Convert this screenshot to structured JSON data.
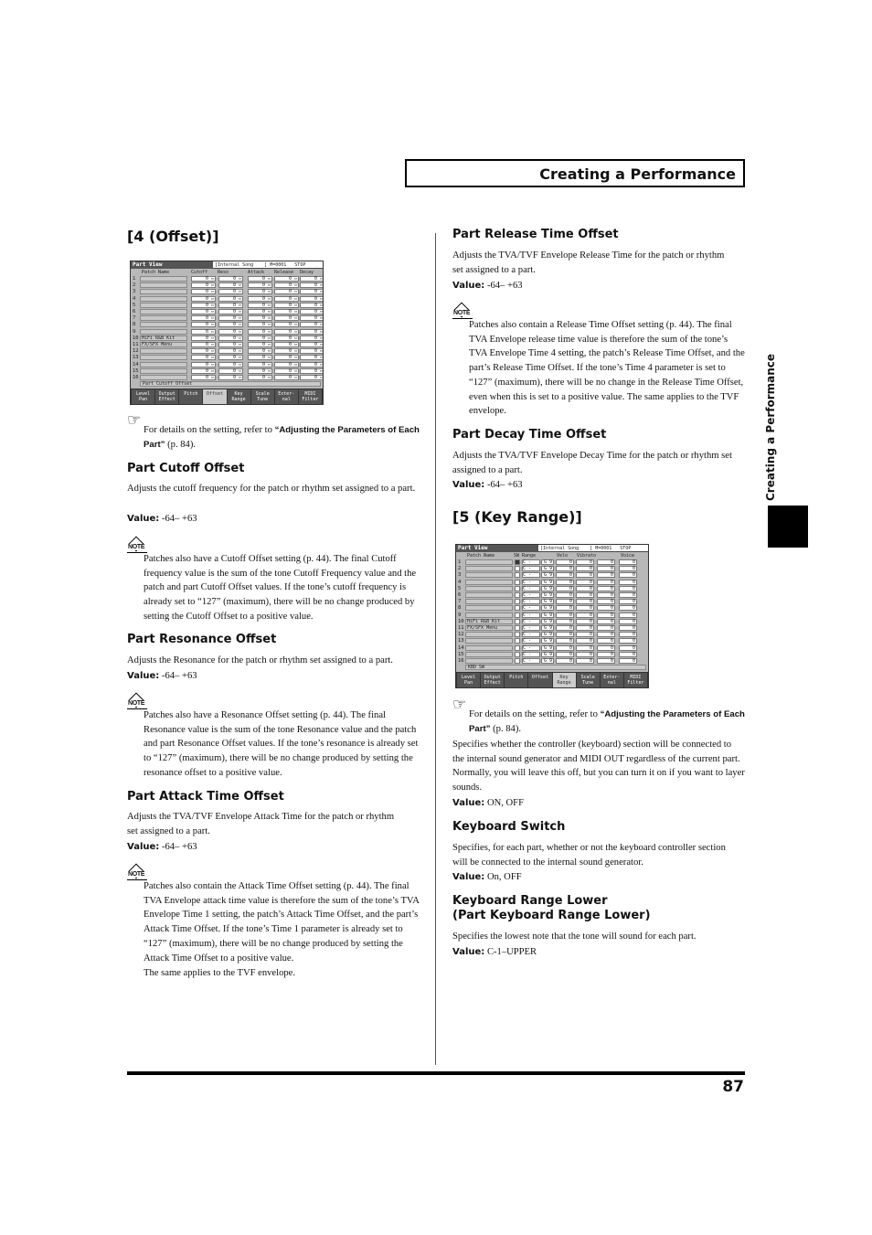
{
  "header": {
    "title": "Creating a Performance"
  },
  "side_tab": "Creating a Performance",
  "page_number": "87",
  "left": {
    "section_title": "[4 (Offset)]",
    "screen": {
      "title": "Part View",
      "info": "[Internal Song    ] M=0001   STOP",
      "columns": [
        "Patch Name",
        "Cutoff",
        "Reso",
        "Attack",
        "Release",
        "Decay"
      ],
      "rows": [
        "",
        "",
        "",
        "",
        "",
        "",
        "",
        "",
        "",
        "HiFi R&B Kit",
        "FX/SFX Menu",
        "",
        "",
        "",
        "",
        ""
      ],
      "value": "0",
      "status": "Part Cutoff Offset",
      "tabs": [
        "Level Pan",
        "Output Effect",
        "Pitch",
        "Offset",
        "Key Range",
        "Scale Tune",
        "Exter- nal",
        "MIDI Filter"
      ],
      "selected_tab": 3
    },
    "ref": {
      "text": "For details on the setting, refer to ",
      "bold": "“Adjusting the Parameters of Each Part”",
      "page": " (p. 84)."
    },
    "items": [
      {
        "title": "Part Cutoff Offset",
        "desc": "Adjusts the cutoff frequency for the patch or rhythm set assigned to a part.",
        "value_label": "Value:",
        "value": "-64– +63",
        "note": "Patches also have a Cutoff Offset setting (p. 44). The final Cutoff frequency value is the sum of the tone Cutoff Frequency value and the patch and part Cutoff Offset values. If the tone’s cutoff frequency is already set to “127” (maximum), there will be no change produced by setting the Cutoff Offset to a positive value."
      },
      {
        "title": "Part Resonance Offset",
        "desc": "Adjusts the Resonance for the patch or rhythm set assigned to a part.",
        "value_label": "Value:",
        "value": "-64– +63",
        "note": "Patches also have a Resonance Offset setting (p. 44). The final Resonance value is the sum of the tone Resonance value and the patch and part Resonance Offset values. If the tone’s resonance is already set to “127” (maximum), there will be no change produced by setting the resonance offset to a positive value."
      },
      {
        "title": "Part Attack Time Offset",
        "desc": "Adjusts the TVA/TVF Envelope Attack Time for the patch or rhythm set assigned to a part.",
        "value_label": "Value:",
        "value": "-64– +63",
        "note": "Patches also contain the Attack Time Offset setting (p. 44). The final TVA Envelope attack time value is therefore the sum of the tone’s TVA Envelope Time 1 setting, the patch’s Attack Time Offset, and the part’s Attack Time Offset. If the tone’s Time 1 parameter is already set to “127” (maximum), there will be no change produced by setting the Attack Time Offset to a positive value.",
        "note2": "The same applies to the TVF envelope."
      }
    ],
    "note_label": "NOTE"
  },
  "right": {
    "items": [
      {
        "title": "Part Release Time Offset",
        "desc": "Adjusts the TVA/TVF Envelope Release Time for the patch or rhythm set assigned to a part.",
        "value_label": "Value:",
        "value": "-64– +63",
        "note": "Patches also contain a Release Time Offset setting (p. 44). The final TVA Envelope release time value is therefore the sum of the tone’s TVA Envelope Time 4 setting, the patch’s Release Time Offset, and the part’s Release Time Offset. If the tone’s Time 4 parameter is set to “127” (maximum), there will be no change in the Release Time Offset, even when this is set to a positive value. The same applies to the TVF envelope."
      },
      {
        "title": "Part Decay Time Offset",
        "desc": "Adjusts the TVA/TVF Envelope Decay Time for the patch or rhythm set assigned to a part.",
        "value_label": "Value:",
        "value": "-64– +63"
      }
    ],
    "section_title": "[5 (Key Range)]",
    "screen": {
      "title": "Part View",
      "info": "[Internal Song    ] M=0001   STOP",
      "columns": [
        "Patch Name",
        "SW",
        "Range",
        "Velo",
        "Vibrato",
        "Voice"
      ],
      "rows": [
        "",
        "",
        "",
        "",
        "",
        "",
        "",
        "",
        "",
        "HiFi R&B Kit",
        "FX/SFX Menu",
        "",
        "",
        "",
        "",
        ""
      ],
      "range": [
        "C -",
        "G 9"
      ],
      "value": "0",
      "status": "KBD SW",
      "tabs": [
        "Level Pan",
        "Output Effect",
        "Pitch",
        "Offset",
        "Key Range",
        "Scale Tune",
        "Exter- nal",
        "MIDI Filter"
      ],
      "selected_tab": 4
    },
    "ref": {
      "text": "For details on the setting, refer to ",
      "bold": "“Adjusting the Parameters of Each Part”",
      "page": " (p. 84)."
    },
    "kbd_desc": "Specifies whether the controller (keyboard) section will be connected to the internal sound generator and MIDI OUT regardless of the current part. Normally, you will leave this off, but you can turn it on if you want to layer sounds.",
    "kbd_value_label": "Value:",
    "kbd_value": "ON, OFF",
    "items2": [
      {
        "title": "Keyboard Switch",
        "desc": "Specifies, for each part, whether or not the keyboard controller section will be connected to the internal sound generator.",
        "value_label": "Value:",
        "value": "On, OFF"
      },
      {
        "title": "Keyboard Range Lower",
        "title2": "(Part Keyboard Range Lower)",
        "desc": "Specifies the lowest note that the tone will sound for each part.",
        "value_label": "Value:",
        "value": "C-1–UPPER"
      }
    ]
  }
}
